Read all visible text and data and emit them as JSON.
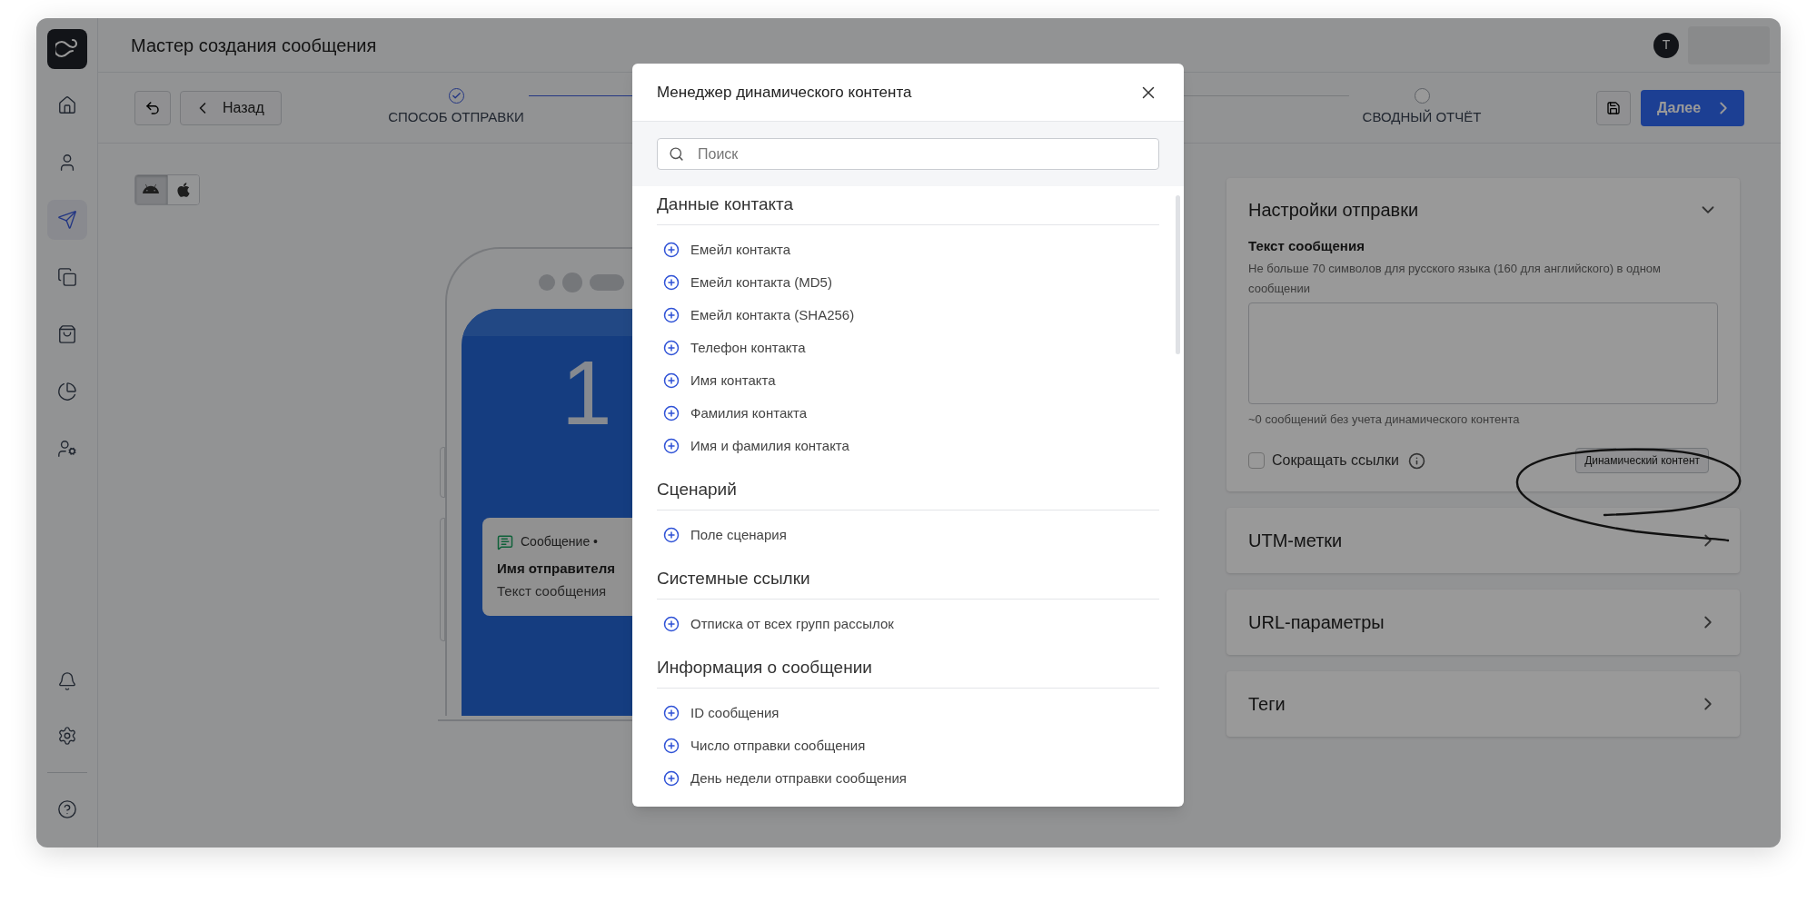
{
  "sidebar": {
    "top_items": [
      {
        "selected": false
      },
      {
        "selected": false
      },
      {
        "selected": true
      },
      {
        "selected": false
      },
      {
        "selected": false
      },
      {
        "selected": false
      },
      {
        "selected": false
      }
    ],
    "bottom_items": [
      {
        "selected": false
      },
      {
        "selected": false
      },
      {
        "selected": false
      }
    ]
  },
  "header": {
    "title": "Мастер создания сообщения",
    "avatar_letter": "T"
  },
  "toolbar": {
    "back_button": "Назад",
    "steps": [
      {
        "label": "СПОСОБ ОТПРАВКИ",
        "done": true
      },
      {
        "label": "СВОДНЫЙ ОТЧЁТ",
        "done": false
      }
    ],
    "next_button": "Далее"
  },
  "platforms": [
    {
      "selected": true
    },
    {
      "selected": false
    }
  ],
  "phone": {
    "clock": "1",
    "notification": {
      "app": "Сообщение •",
      "sender": "Имя отправителя",
      "text": "Текст сообщения"
    }
  },
  "settings_panel": {
    "title": "Настройки отправки",
    "expanded": true,
    "message_label": "Текст сообщения",
    "hint": "Не больше 70 символов для русского языка (160 для английского) в одном сообщении",
    "count": "~0 сообщений без учета динамического контента",
    "shorten_links": {
      "label": "Сокращать ссылки",
      "checked": false
    },
    "dynamic_button": "Динамический контент"
  },
  "sections": [
    {
      "title": "UTM-метки",
      "expanded": false
    },
    {
      "title": "URL-параметры",
      "expanded": false
    },
    {
      "title": "Теги",
      "expanded": false
    }
  ],
  "modal": {
    "title": "Менеджер динамического контента",
    "search": {
      "placeholder": "Поиск"
    },
    "groups": [
      {
        "title": "Данные контакта",
        "items": [
          "Емейл контакта",
          "Емейл контакта (MD5)",
          "Емейл контакта (SHA256)",
          "Телефон контакта",
          "Имя контакта",
          "Фамилия контакта",
          "Имя и фамилия контакта"
        ]
      },
      {
        "title": "Сценарий",
        "items": [
          "Поле сценария"
        ]
      },
      {
        "title": "Системные ссылки",
        "items": [
          "Отписка от всех групп рассылок"
        ]
      },
      {
        "title": "Информация о сообщении",
        "items": [
          "ID сообщения",
          "Число отправки сообщения",
          "День недели отправки сообщения"
        ]
      }
    ]
  }
}
